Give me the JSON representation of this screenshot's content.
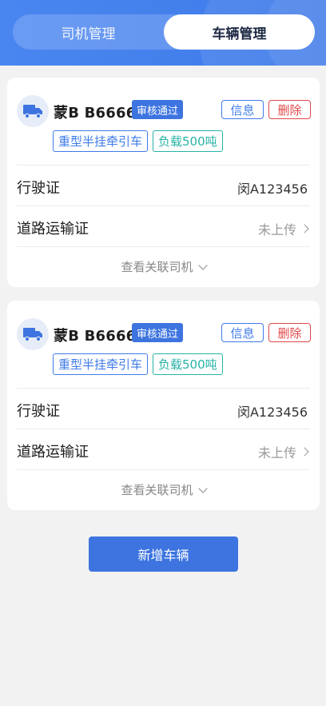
{
  "tabs": [
    {
      "label": "司机管理",
      "active": false
    },
    {
      "label": "车辆管理",
      "active": true
    }
  ],
  "vehicles": [
    {
      "plate": "蒙B B6666",
      "status": "审核通过",
      "info_label": "信息",
      "delete_label": "删除",
      "type_tag": "重型半挂牵引车",
      "load_tag": "负载500吨",
      "license_label": "行驶证",
      "license_value": "闵A123456",
      "transport_label": "道路运输证",
      "transport_value": "未上传",
      "view_drivers": "查看关联司机"
    },
    {
      "plate": "蒙B B6666",
      "status": "审核通过",
      "info_label": "信息",
      "delete_label": "删除",
      "type_tag": "重型半挂牵引车",
      "load_tag": "负载500吨",
      "license_label": "行驶证",
      "license_value": "闵A123456",
      "transport_label": "道路运输证",
      "transport_value": "未上传",
      "view_drivers": "查看关联司机"
    }
  ],
  "add_button": "新增车辆",
  "colors": {
    "primary": "#3f7be9",
    "danger": "#e04848",
    "teal": "#27b3a6",
    "background": "#f2f2f2"
  },
  "icons": {
    "truck": "truck-icon",
    "chevron_right": "chevron-right-icon",
    "chevron_down": "chevron-down-icon"
  }
}
